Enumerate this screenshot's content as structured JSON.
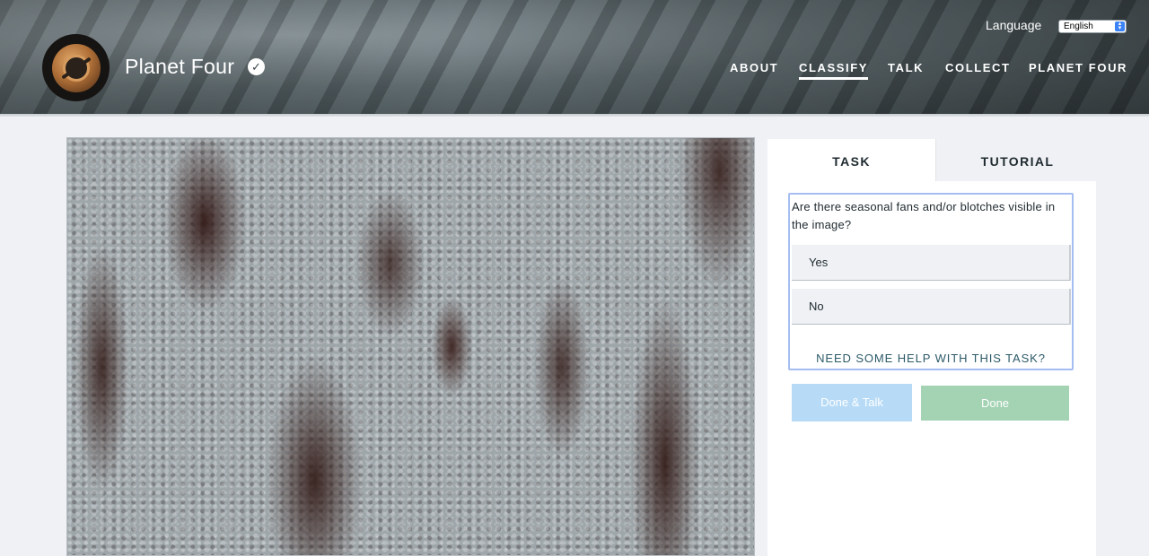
{
  "header": {
    "site_title": "Planet Four",
    "language_label": "Language",
    "language_value": "English"
  },
  "nav": {
    "items": [
      {
        "label": "ABOUT",
        "active": false
      },
      {
        "label": "CLASSIFY",
        "active": true
      },
      {
        "label": "TALK",
        "active": false
      },
      {
        "label": "COLLECT",
        "active": false
      },
      {
        "label": "PLANET FOUR",
        "active": false
      }
    ]
  },
  "panel": {
    "tabs": [
      {
        "label": "TASK",
        "active": true
      },
      {
        "label": "TUTORIAL",
        "active": false
      }
    ],
    "question": "Are there seasonal fans and/or blotches visible in the image?",
    "answers": [
      {
        "label": "Yes"
      },
      {
        "label": "No"
      }
    ],
    "help_link": "NEED SOME HELP WITH THIS TASK?",
    "buttons": {
      "done_talk": "Done & Talk",
      "done": "Done"
    }
  },
  "colors": {
    "page_background": "#eff1f4",
    "task_border": "#a5bdf0",
    "done_talk_button": "#b7dbf7",
    "done_button": "#a4d3b4",
    "help_link": "#2c5a68"
  },
  "icons": {
    "logo": "planet-four-logo-icon",
    "verified": "check-circle-icon",
    "select_arrow": "chevron-updown-icon"
  }
}
